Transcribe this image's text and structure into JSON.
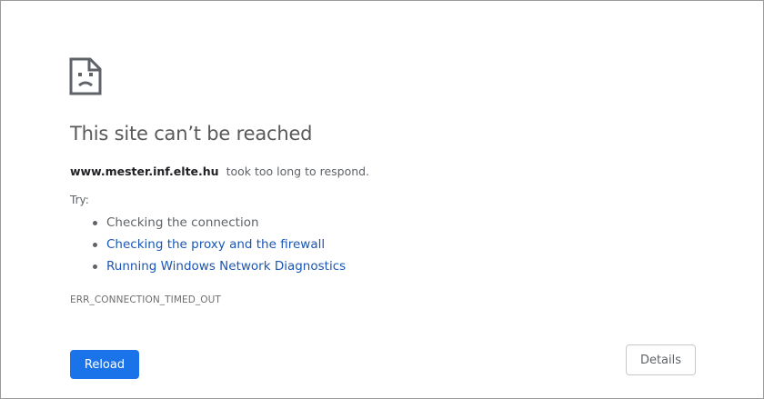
{
  "error": {
    "title": "This site can’t be reached",
    "host": "www.mester.inf.elte.hu",
    "message": "took too long to respond.",
    "try_label": "Try:",
    "suggestions": [
      "Checking the connection",
      "Checking the proxy and the firewall",
      "Running Windows Network Diagnostics"
    ],
    "code": "ERR_CONNECTION_TIMED_OUT",
    "icon": "sad-page-icon"
  },
  "buttons": {
    "reload_label": "Reload",
    "details_label": "Details"
  },
  "colors": {
    "primary_button": "#1a73e8",
    "link": "#1a56b6",
    "title": "#595959",
    "text": "#5f6368"
  }
}
